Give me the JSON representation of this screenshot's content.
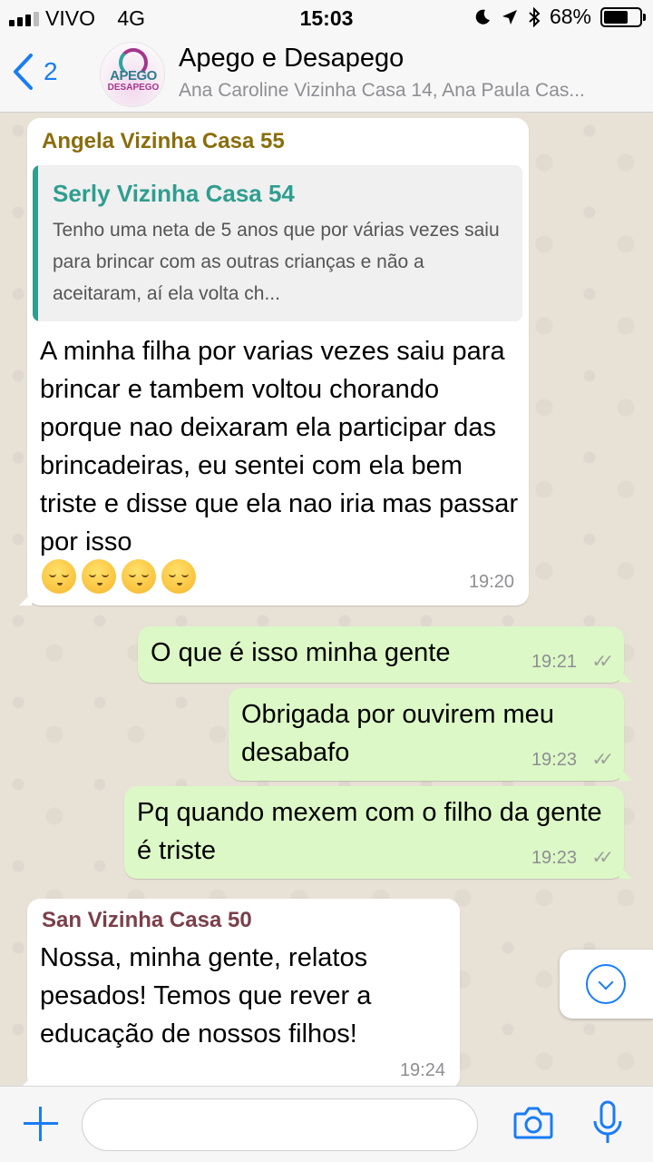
{
  "status_bar": {
    "carrier": "VIVO",
    "network": "4G",
    "time": "15:03",
    "battery": "68%",
    "battery_level": 0.68
  },
  "header": {
    "back_count": "2",
    "avatar_line1": "APEGO",
    "avatar_line2": "DESAPEGO",
    "title": "Apego e Desapego",
    "subtitle": "Ana Caroline Vizinha Casa 14, Ana Paula Cas..."
  },
  "messages": [
    {
      "sender": "Angela Vizinha Casa 55",
      "sender_color": "#8a6d0b",
      "quote_name": "Serly Vizinha Casa 54",
      "quote_text": "Tenho uma neta de 5 anos que por várias vezes saiu para brincar com as outras crianças e não a aceitaram, aí ela volta ch...",
      "text": "A minha filha por varias vezes saiu para brincar e tambem voltou chorando porque nao deixaram ela participar das brincadeiras, eu sentei com ela bem triste e disse que ela nao iria mas passar por isso",
      "emojis": [
        "pensive-face",
        "pensive-face",
        "pensive-face",
        "pensive-face"
      ],
      "time": "19:20"
    },
    {
      "text": "O que é isso minha gente",
      "time": "19:21"
    },
    {
      "text": "Obrigada por ouvirem meu desabafo",
      "time": "19:23"
    },
    {
      "text": "Pq quando mexem com o filho da gente é triste",
      "time": "19:23"
    },
    {
      "sender": "San Vizinha Casa 50",
      "sender_color": "#7b3f4a",
      "text": "Nossa, minha gente, relatos pesados! Temos que rever a educação de nossos filhos!",
      "time": "19:24"
    }
  ],
  "input": {
    "placeholder": ""
  },
  "colors": {
    "accent": "#1a7cf5",
    "outgoing_bubble": "#dcf8c6",
    "incoming_bubble": "#ffffff",
    "quote_accent": "#2f9e8f",
    "chat_background": "#e8e1d6"
  },
  "icons": {
    "back": "chevron-left-icon",
    "scroll_down": "chevron-down-circle-icon",
    "attach": "plus-icon",
    "camera": "camera-icon",
    "mic": "microphone-icon",
    "read_receipt": "double-check-icon"
  }
}
